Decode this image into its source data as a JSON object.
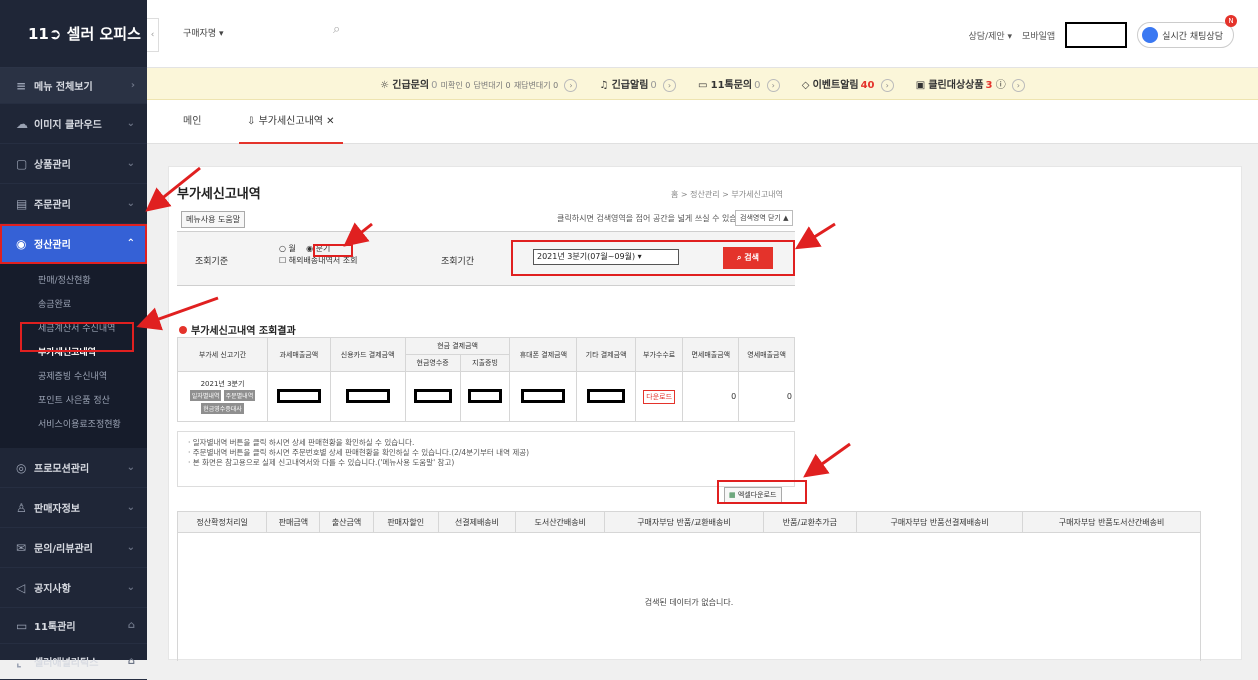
{
  "sidebar": {
    "logo": "11➲ 셀러 오피스",
    "menu_all": "메뉴 전체보기",
    "items": [
      {
        "icon": "cloud-icon",
        "label": "이미지 클라우드"
      },
      {
        "icon": "box-icon",
        "label": "상품관리"
      },
      {
        "icon": "order-icon",
        "label": "주문관리"
      },
      {
        "icon": "settlement-icon",
        "label": "정산관리"
      }
    ],
    "submenu": [
      "판매/정산현황",
      "송금완료",
      "세금계산서 수신내역",
      "부가세신고내역",
      "공제증빙 수신내역",
      "포인트 사은품 정산",
      "서비스이용료조정현황"
    ],
    "items_bottom": [
      {
        "icon": "promo-icon",
        "label": "프로모션관리"
      },
      {
        "icon": "user-icon",
        "label": "판매자정보"
      },
      {
        "icon": "inquiry-icon",
        "label": "문의/리뷰관리"
      },
      {
        "icon": "megaphone-icon",
        "label": "공지사항"
      },
      {
        "icon": "chat-icon",
        "label": "11톡관리"
      },
      {
        "icon": "analytics-icon",
        "label": "셀러애널리틱스"
      }
    ]
  },
  "topbar": {
    "search_select": "구매자명",
    "links": [
      "상담/제안",
      "모바일앱"
    ],
    "chat_label": "실시간 채팅상담",
    "chat_badge": "N"
  },
  "alerts": {
    "urgent_label": "긴급문의",
    "urgent_count": "0",
    "sub1": "미확인 0",
    "sub2": "답변대기 0",
    "sub3": "재답변대기 0",
    "alarm_label": "긴급알림",
    "alarm_count": "0",
    "talk_label": "11톡문의",
    "talk_count": "0",
    "event_label": "이벤트알림",
    "event_count": "40",
    "clean_label": "클린대상상품",
    "clean_count": "3"
  },
  "tabs": [
    "메인",
    "부가세신고내역"
  ],
  "page": {
    "title": "부가세신고내역",
    "breadcrumb": "홈 > 정산관리 > 부가세신고내역",
    "help_button": "메뉴사용 도움말",
    "notice": "클릭하시면 검색영역을 접어 공간을 넓게 쓰실 수 있습니다.",
    "close_filter": "검색영역 닫기 ▲"
  },
  "filter": {
    "criteria_label": "조회기준",
    "radio_month": "월",
    "radio_quarter": "분기",
    "checkbox_label": "해외배송내역서 조회",
    "period_label": "조회기간",
    "period_value": "2021년 3분기(07월~09월)",
    "search_button": "검색"
  },
  "summary": {
    "title": "부가세신고내역 조회결과",
    "headers": [
      "부가세 신고기간",
      "과세매출금액",
      "신용카드 결제금액",
      "현금 결제금액",
      "휴대폰 결제금액",
      "기타 결제금액",
      "부가수수료",
      "면세매출금액",
      "영세매출금액"
    ],
    "cash_sub": [
      "현금영수증",
      "지출증빙"
    ],
    "row": {
      "period": "2021년 3분기",
      "btn1": "일자별내역",
      "btn2": "주문별내역",
      "btn3": "현금영수증대사",
      "download": "다운로드",
      "tax_free": "0",
      "zero_rated": "0"
    }
  },
  "info": [
    "· 일자별내역 버튼을 클릭 하시면 상세 판매현황을 확인하실 수 있습니다.",
    "· 주문별내역 버튼을 클릭 하시면 주문번호별 상세 판매현황을 확인하실 수 있습니다.(2/4분기부터 내역 제공)",
    "· 본 화면은 참고용으로 실제 신고내역서와 다를 수 있습니다.('메뉴사용 도움말' 참고)"
  ],
  "excel_button": "엑셀다운로드",
  "detail": {
    "headers": [
      "정산확정처리일",
      "판매금액",
      "출산금액",
      "판매자할인",
      "선결제배송비",
      "도서산간배송비",
      "구매자부담 반품/교환배송비",
      "반품/교환추가금",
      "구매자부담 반품선결제배송비",
      "구매자부담 반품도서산간배송비"
    ],
    "empty": "검색된 데이터가 없습니다."
  }
}
